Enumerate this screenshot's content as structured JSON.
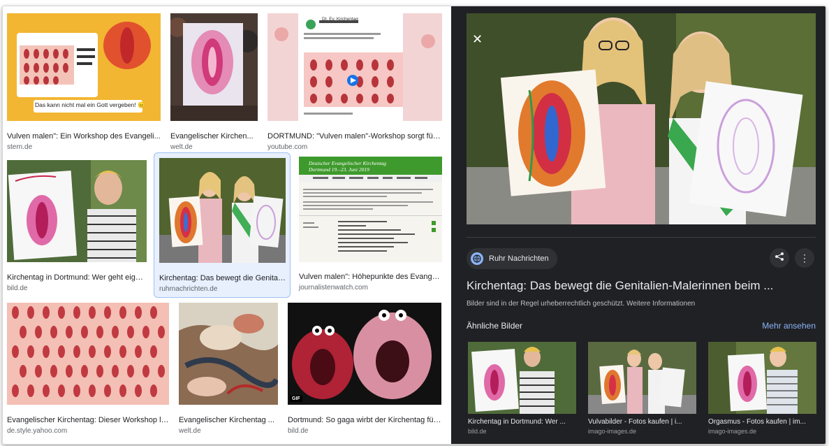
{
  "results": [
    {
      "caption": "Vulven malen\": Ein Workshop des Evangeli...",
      "source": "stern.de",
      "thumb_text": "Das kann nicht mal ein Gott vergeben! 😑"
    },
    {
      "caption": "Evangelischer Kirchen...",
      "source": "welt.de"
    },
    {
      "caption": "DORTMUND: \"Vulven malen\"-Workshop sorgt für ...",
      "source": "youtube.com",
      "thumb_text": "Dt. Ev. Kirchentag"
    },
    {
      "caption": "Kirchentag in Dortmund: Wer geht eigen...",
      "source": "bild.de"
    },
    {
      "caption": "Kirchentag: Das bewegt die Genitali...",
      "source": "ruhrnachrichten.de",
      "selected": true
    },
    {
      "caption": "Vulven malen\": Höhepunkte des Evangeli...",
      "source": "journalistenwatch.com",
      "thumb_text": "Deutscher Evangelischer Kirchentag Dortmund 19.–23. Juni 2019"
    },
    {
      "caption": "Evangelischer Kirchentag: Dieser Workshop lä...",
      "source": "de.style.yahoo.com"
    },
    {
      "caption": "Evangelischer Kirchentag ...",
      "source": "welt.de"
    },
    {
      "caption": "Dortmund: So gaga wirbt der Kirchentag für...",
      "source": "bild.de",
      "badge": "GIF"
    }
  ],
  "panel": {
    "close_icon": "close-icon",
    "source_name": "Ruhr Nachrichten",
    "title": "Kirchentag: Das bewegt die Genitalien-Malerinnen beim ...",
    "copyright": "Bilder sind in der Regel urheberrechtlich geschützt.",
    "more_info": "Weitere Informationen",
    "similar_heading": "Ähnliche Bilder",
    "see_more": "Mehr ansehen",
    "similar": [
      {
        "caption": "Kirchentag in Dortmund: Wer ...",
        "source": "bild.de"
      },
      {
        "caption": "Vulvabilder - Fotos kaufen | i...",
        "source": "imago-images.de"
      },
      {
        "caption": "Orgasmus - Fotos kaufen | im...",
        "source": "imago-images.de"
      }
    ]
  },
  "colors": {
    "panel_bg": "#202124",
    "accent": "#8ab4f8",
    "selected_border": "#9fc0f0"
  }
}
